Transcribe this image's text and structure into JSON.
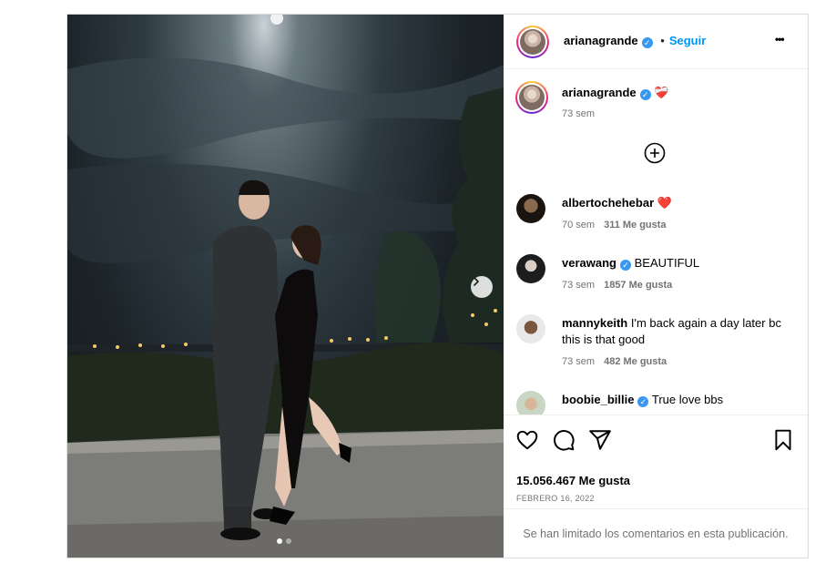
{
  "post": {
    "author": "arianagrande",
    "follow_label": "Seguir",
    "separator": "•",
    "more_glyph": "•••"
  },
  "caption": {
    "username": "arianagrande",
    "emoji": "❤️‍🩹",
    "time": "73 sem"
  },
  "comments": [
    {
      "username": "albertochehebar",
      "text": "❤️",
      "time": "70 sem",
      "likes": "311 Me gusta"
    },
    {
      "username": "verawang",
      "verified": true,
      "text": "BEAUTIFUL",
      "time": "73 sem",
      "likes": "1857 Me gusta"
    },
    {
      "username": "mannykeith",
      "text": "I'm back again a day later bc this is that good",
      "time": "73 sem",
      "likes": "482 Me gusta"
    },
    {
      "username": "boobie_billie",
      "verified": true,
      "text": "True love bbs"
    }
  ],
  "stats": {
    "likes": "15.056.467 Me gusta",
    "date": "FEBRERO 16, 2022"
  },
  "footer": {
    "limited_comments": "Se han limitado los comentarios en esta publicación."
  },
  "carousel": {
    "current": 1,
    "total": 2
  },
  "icons": [
    "more-options-icon",
    "verified-badge-icon",
    "load-more-comments-icon",
    "like-icon",
    "comment-icon",
    "share-icon",
    "save-icon",
    "next-arrow-icon"
  ],
  "colors": {
    "link": "#0095f6",
    "verified": "#3897f0",
    "muted": "#737373",
    "heart": "#ed1c24"
  }
}
